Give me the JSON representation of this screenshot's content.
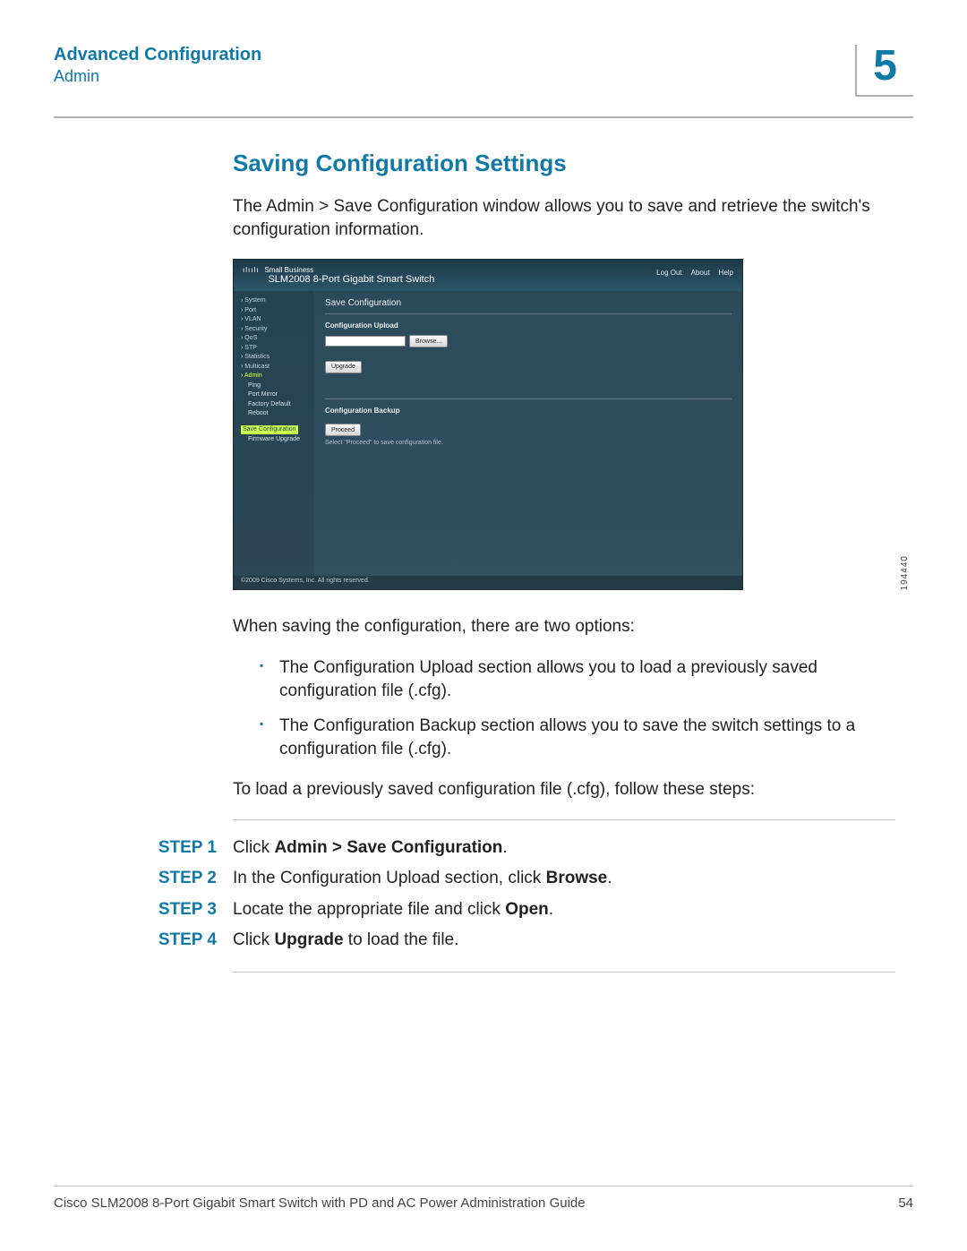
{
  "header": {
    "title": "Advanced Configuration",
    "subtitle": "Admin",
    "chapter": "5"
  },
  "section": {
    "heading": "Saving Configuration Settings",
    "intro": "The Admin > Save Configuration window allows you to save and retrieve the switch's configuration information."
  },
  "screenshot": {
    "brand_tag": "cisco",
    "brand_line": "Small Business",
    "product": "SLM2008 8-Port Gigabit Smart Switch",
    "links": {
      "logout": "Log Out",
      "about": "About",
      "help": "Help"
    },
    "nav": [
      "› System",
      "› Port",
      "› VLAN",
      "› Security",
      "› QoS",
      "› STP",
      "› Statistics",
      "› Multicast"
    ],
    "nav_admin": "› Admin",
    "nav_admin_children": [
      "Ping",
      "Port Mirror",
      "Factory Default",
      "Reboot"
    ],
    "nav_active": "Save Configuration",
    "nav_last": "Firmware Upgrade",
    "panel_title": "Save Configuration",
    "upload_hdr": "Configuration Upload",
    "browse": "Browse...",
    "upgrade": "Upgrade",
    "backup_hdr": "Configuration Backup",
    "proceed": "Proceed",
    "hint": "Select \"Proceed\" to save configuration file.",
    "copyright": "©2009 Cisco Systems, Inc. All rights reserved.",
    "image_id": "194440"
  },
  "after_img": "When saving the configuration, there are two options:",
  "bullets": [
    "The Configuration Upload section allows you to load a previously saved configuration file (.cfg).",
    "The Configuration Backup section allows you to save the switch settings to a configuration file (.cfg)."
  ],
  "lead_in": "To load a previously saved configuration file (.cfg), follow these steps:",
  "steps": [
    {
      "label": "STEP 1",
      "pre": "Click ",
      "bold": "Admin > Save Configuration",
      "post": "."
    },
    {
      "label": "STEP 2",
      "pre": "In the Configuration Upload section, click ",
      "bold": "Browse",
      "post": "."
    },
    {
      "label": "STEP 3",
      "pre": "Locate the appropriate file and click ",
      "bold": "Open",
      "post": "."
    },
    {
      "label": "STEP 4",
      "pre": "Click ",
      "bold": "Upgrade",
      "post": " to load the file."
    }
  ],
  "footer": {
    "text": "Cisco SLM2008 8-Port Gigabit Smart Switch with PD and AC Power Administration Guide",
    "page": "54"
  }
}
